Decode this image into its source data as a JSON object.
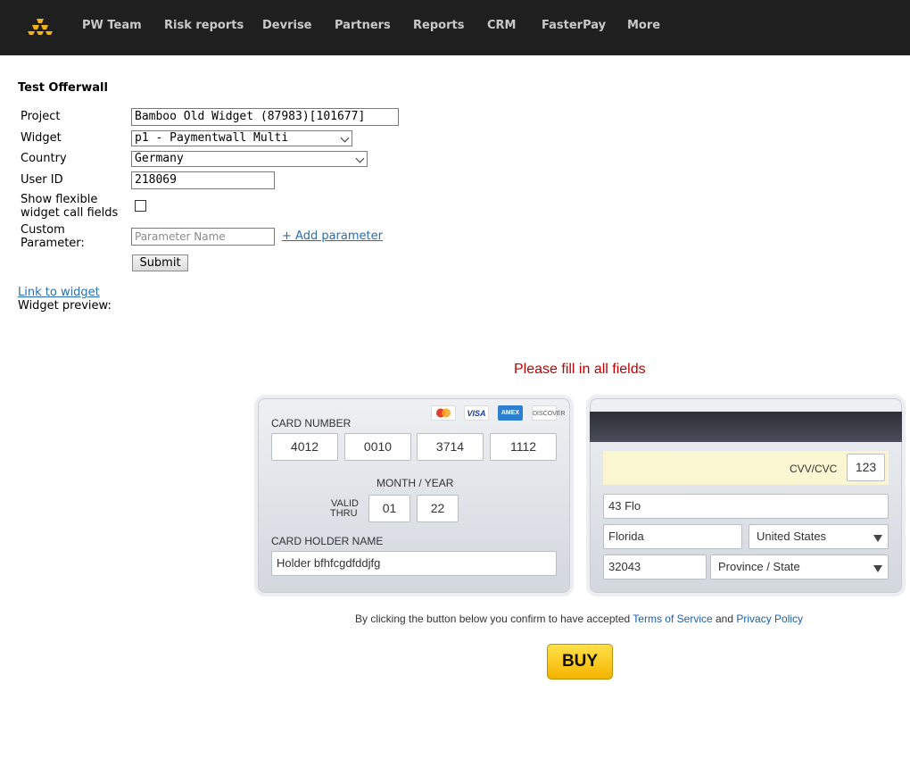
{
  "nav": {
    "items": [
      "PW Team",
      "Risk reports",
      "Devrise",
      "Partners",
      "Reports",
      "CRM",
      "FasterPay",
      "More"
    ],
    "logo_icon": "gold-bars-icon"
  },
  "form": {
    "title": "Test Offerwall",
    "project_label": "Project",
    "project_value": "Bamboo Old Widget (87983)[101677]",
    "widget_label": "Widget",
    "widget_value": "p1 - Paymentwall Multi",
    "country_label": "Country",
    "country_value": "Germany",
    "userid_label": "User ID",
    "userid_value": "218069",
    "flexible_label_line1": "Show flexible",
    "flexible_label_line2": "widget call fields",
    "flexible_checked": false,
    "custom_label_line1": "Custom",
    "custom_label_line2": "Parameter:",
    "param_placeholder": "Parameter Name",
    "add_param": "+ Add parameter",
    "submit": "Submit",
    "link_to_widget": "Link to widget",
    "preview_label": "Widget preview:"
  },
  "widget": {
    "error": "Please fill in all fields",
    "card_number_label": "CARD NUMBER",
    "card_number": [
      "4012",
      "0010",
      "3714",
      "1112"
    ],
    "card_brands": [
      "MasterCard",
      "VISA",
      "AMEX",
      "DISCOVER"
    ],
    "month_year_label": "MONTH / YEAR",
    "valid_line1": "VALID",
    "valid_line2": "THRU",
    "month": "01",
    "year": "22",
    "holder_label": "CARD HOLDER NAME",
    "holder_value": "Holder bfhfcgdfddjfg",
    "cvv_label": "CVV/CVC",
    "cvv_value": "123",
    "address": "43 Flo",
    "city": "Florida",
    "country": "United States",
    "zip": "32043",
    "state": "Province / State",
    "terms_prefix": "By clicking the button below you confirm to have accepted ",
    "terms_link": "Terms of Service",
    "terms_and": " and ",
    "privacy_link": "Privacy Policy",
    "buy": "BUY"
  }
}
